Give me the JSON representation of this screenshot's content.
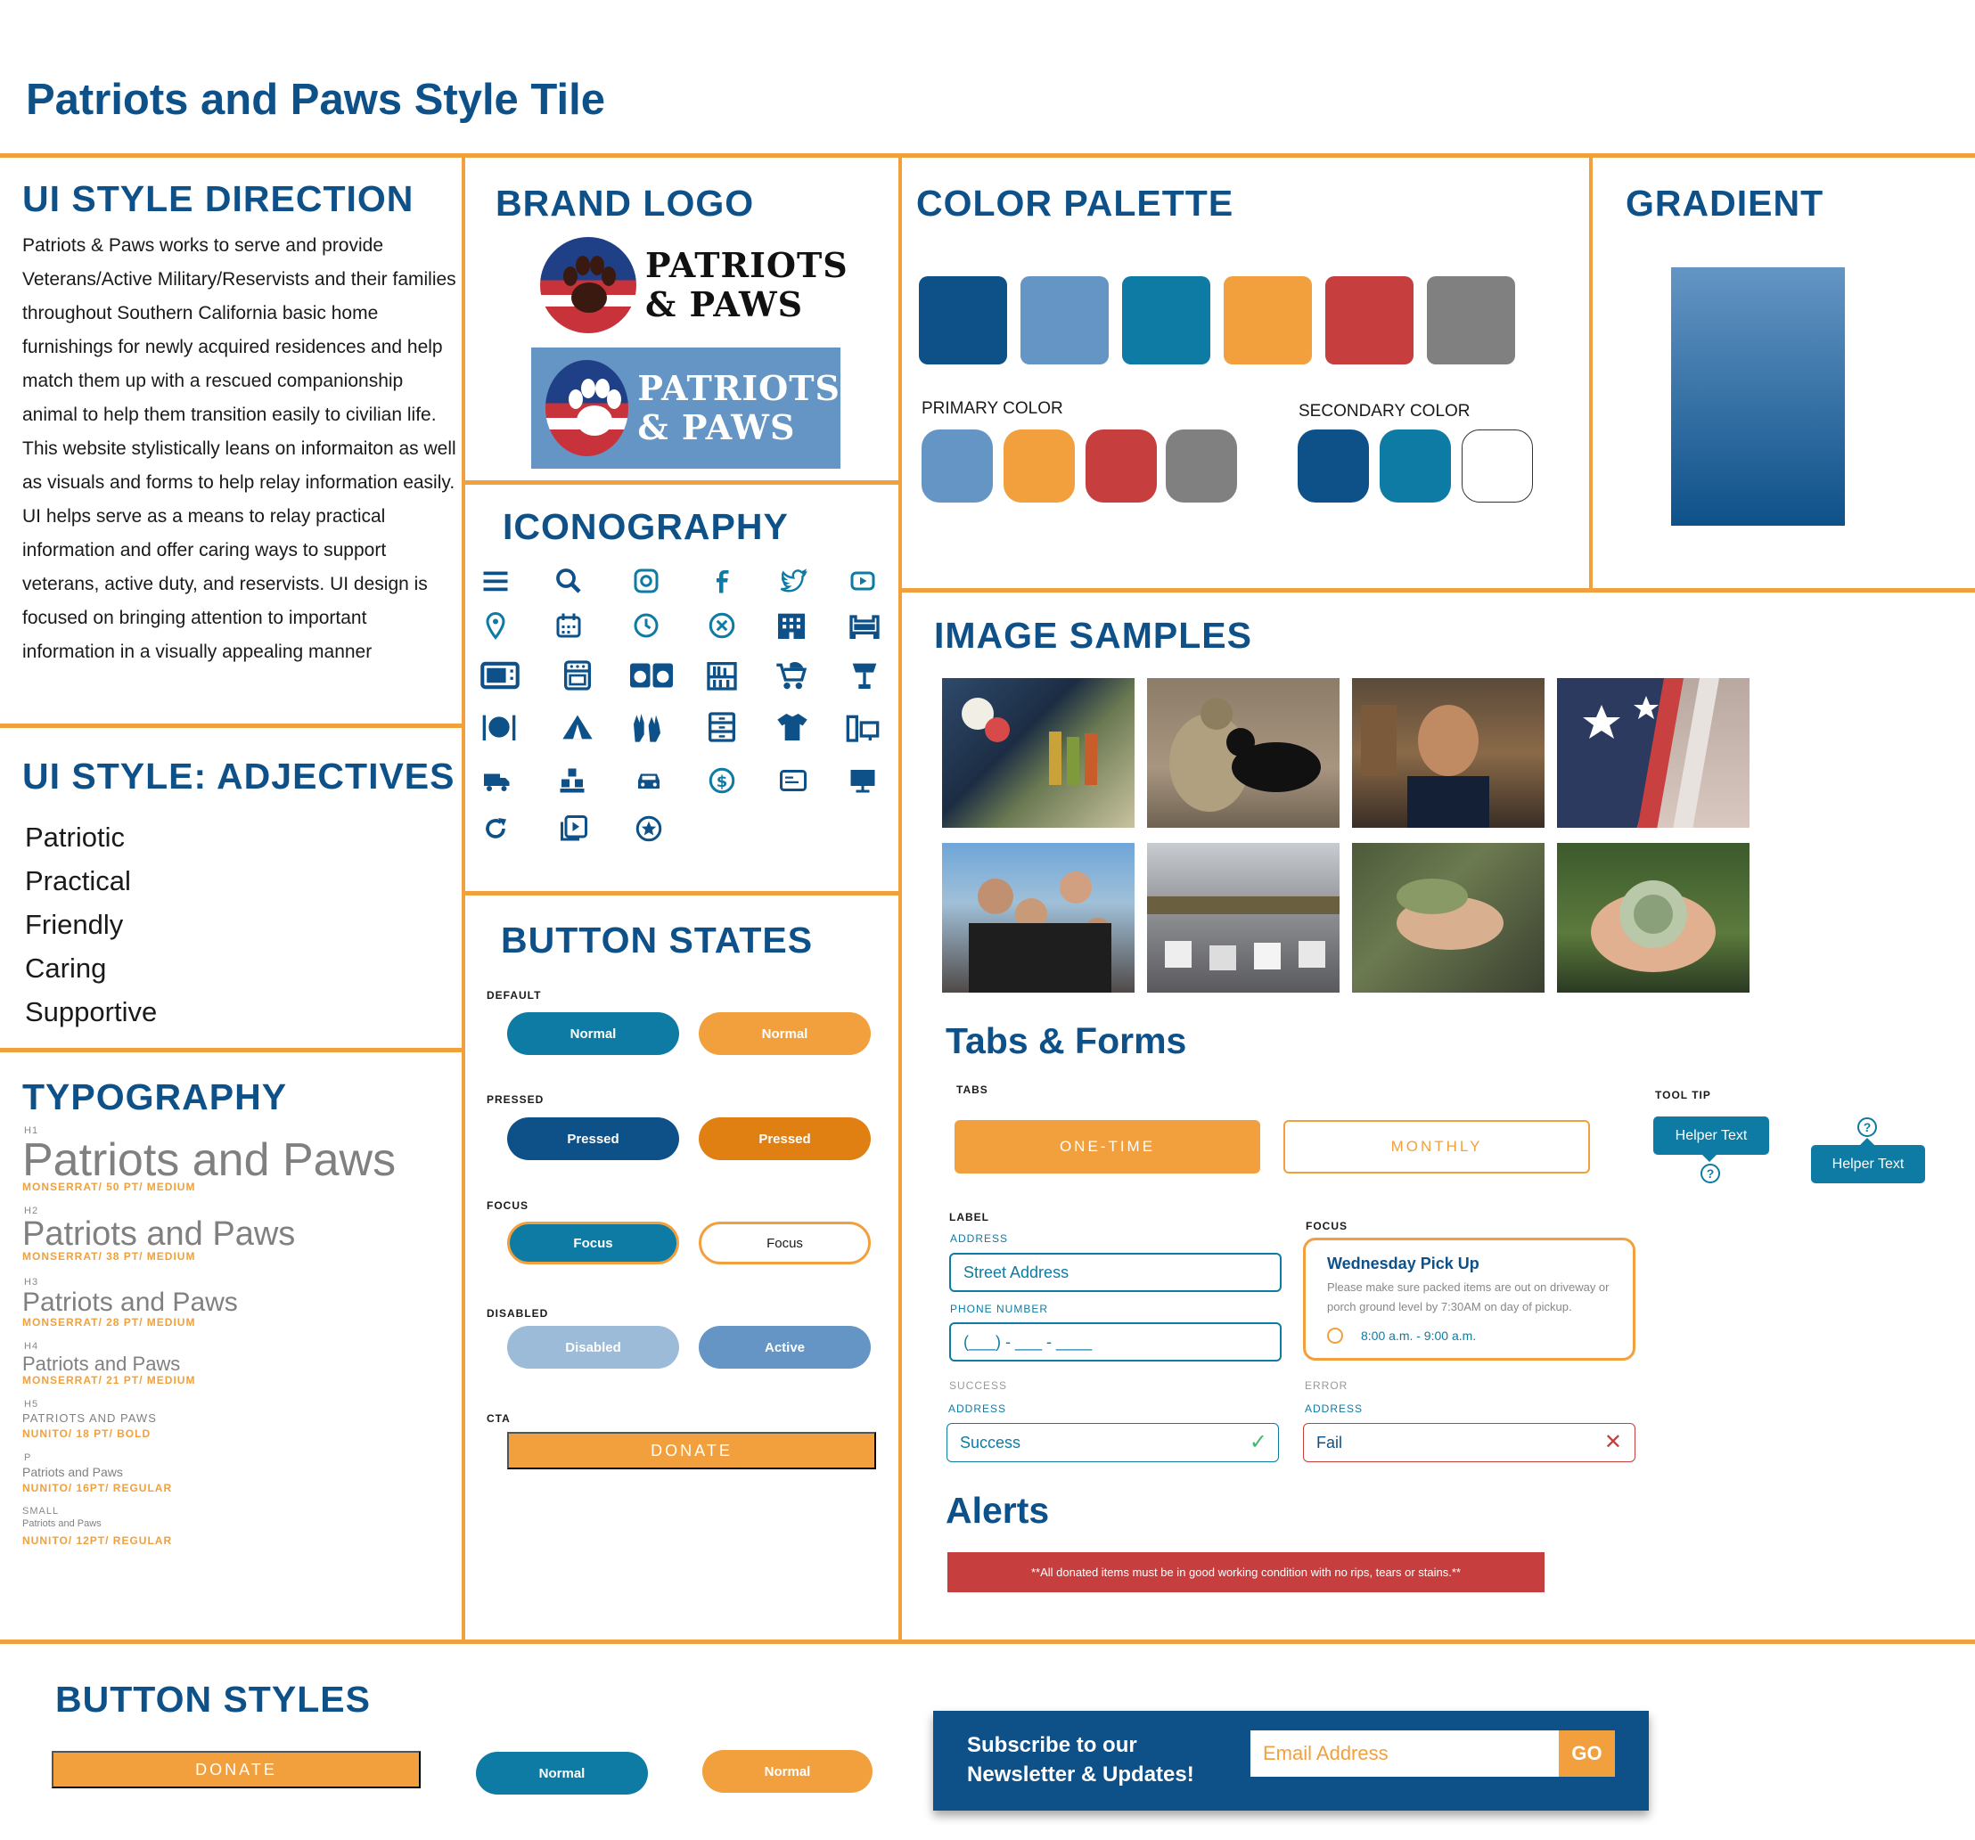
{
  "page": {
    "title": "Patriots and Paws Style Tile"
  },
  "direction": {
    "title": "UI STYLE DIRECTION",
    "body": "Patriots & Paws works to serve and provide Veterans/Active Military/Reservists and their families throughout Southern California basic home furnishings for newly acquired residences and help match them up with a rescued companionship animal to help them transition easily to civilian life. This website stylistically leans on informaiton as well as visuals and forms to help relay information easily. UI helps serve as a means to relay practical information and offer caring ways to support veterans, active duty, and reservists. UI design is focused on bringing attention to important information in a visually appealing manner"
  },
  "adjectives": {
    "title": "UI STYLE: ADJECTIVES",
    "items": [
      "Patriotic",
      "Practical",
      "Friendly",
      "Caring",
      "Supportive"
    ]
  },
  "typography": {
    "title": "TYPOGRAPHY",
    "levels": [
      {
        "tag": "H1",
        "sample": "Patriots and Paws",
        "meta": "MONSERRAT/ 50 PT/ MEDIUM"
      },
      {
        "tag": "H2",
        "sample": "Patriots and Paws",
        "meta": "MONSERRAT/ 38 PT/ MEDIUM"
      },
      {
        "tag": "H3",
        "sample": "Patriots and Paws",
        "meta": "MONSERRAT/ 28 PT/ MEDIUM"
      },
      {
        "tag": "H4",
        "sample": "Patriots and Paws",
        "meta": "MONSERRAT/ 21 PT/ MEDIUM"
      },
      {
        "tag": "H5",
        "sample": "PATRIOTS AND PAWS",
        "meta": "NUNITO/ 18 PT/ BOLD"
      },
      {
        "tag": "P",
        "sample": "Patriots and Paws",
        "meta": "NUNITO/ 16PT/ REGULAR"
      },
      {
        "tag": "SMALL",
        "sample": "Patriots and Paws",
        "meta": "NUNITO/ 12PT/ REGULAR"
      }
    ]
  },
  "brand": {
    "title": "BRAND LOGO",
    "logo_line1": "PATRIOTS",
    "logo_line2": "& PAWS"
  },
  "iconography": {
    "title": "ICONOGRAPHY"
  },
  "button_states": {
    "title": "BUTTON STATES",
    "default_label": "DEFAULT",
    "pressed_label": "PRESSED",
    "focus_label": "FOCUS",
    "disabled_label": "DISABLED",
    "cta_label": "CTA",
    "normal": "Normal",
    "pressed": "Pressed",
    "focus": "Focus",
    "disabled": "Disabled",
    "active": "Active",
    "donate": "DONATE"
  },
  "palette": {
    "title": "COLOR PALETTE",
    "swatches": [
      "#0e5189",
      "#6495c4",
      "#0d7ba3",
      "#f2a03d",
      "#c63e3e",
      "#808080"
    ],
    "primary_label": "PRIMARY COLOR",
    "primary": [
      "#6495c4",
      "#f2a03d",
      "#c63e3e",
      "#808080"
    ],
    "secondary_label": "SECONDARY COLOR",
    "secondary": [
      "#0e5189",
      "#0d7ba3",
      "#ffffff"
    ]
  },
  "gradient": {
    "title": "GRADIENT",
    "from": "#6495c4",
    "to": "#0e5189"
  },
  "images": {
    "title": "IMAGE SAMPLES"
  },
  "tabs_forms": {
    "title": "Tabs & Forms",
    "tabs_label": "TABS",
    "tab_one": "ONE-TIME",
    "tab_two": "MONTHLY",
    "tooltip_label": "TOOL TIP",
    "helper": "Helper Text",
    "label_label": "LABEL",
    "address_label": "ADDRESS",
    "street_address": "Street Address",
    "phone_label": "PHONE NUMBER",
    "phone_value": "(___) - ___ - ____",
    "focus_label": "FOCUS",
    "focus_title": "Wednesday Pick Up",
    "focus_body": "Please make sure packed items are out on driveway or porch ground level by 7:30AM on day of pickup.",
    "focus_time": "8:00 a.m. - 9:00  a.m.",
    "success_label": "SUCCESS",
    "success_value": "Success",
    "error_label": "ERROR",
    "error_value": "Fail"
  },
  "alerts": {
    "title": "Alerts",
    "message": "**All donated items must be in good working condition with no rips, tears or stains.**"
  },
  "button_styles": {
    "title": "BUTTON STYLES",
    "donate": "DONATE",
    "normal": "Normal"
  },
  "newsletter": {
    "line1": "Subscribe to our",
    "line2": "Newsletter & Updates!",
    "placeholder": "Email Address",
    "go": "GO"
  },
  "colors": {
    "navy": "#0e5189",
    "teal": "#0d7ba3",
    "light_blue": "#6495c4",
    "orange": "#f2a03d",
    "red": "#c63e3e",
    "gray": "#808080"
  }
}
